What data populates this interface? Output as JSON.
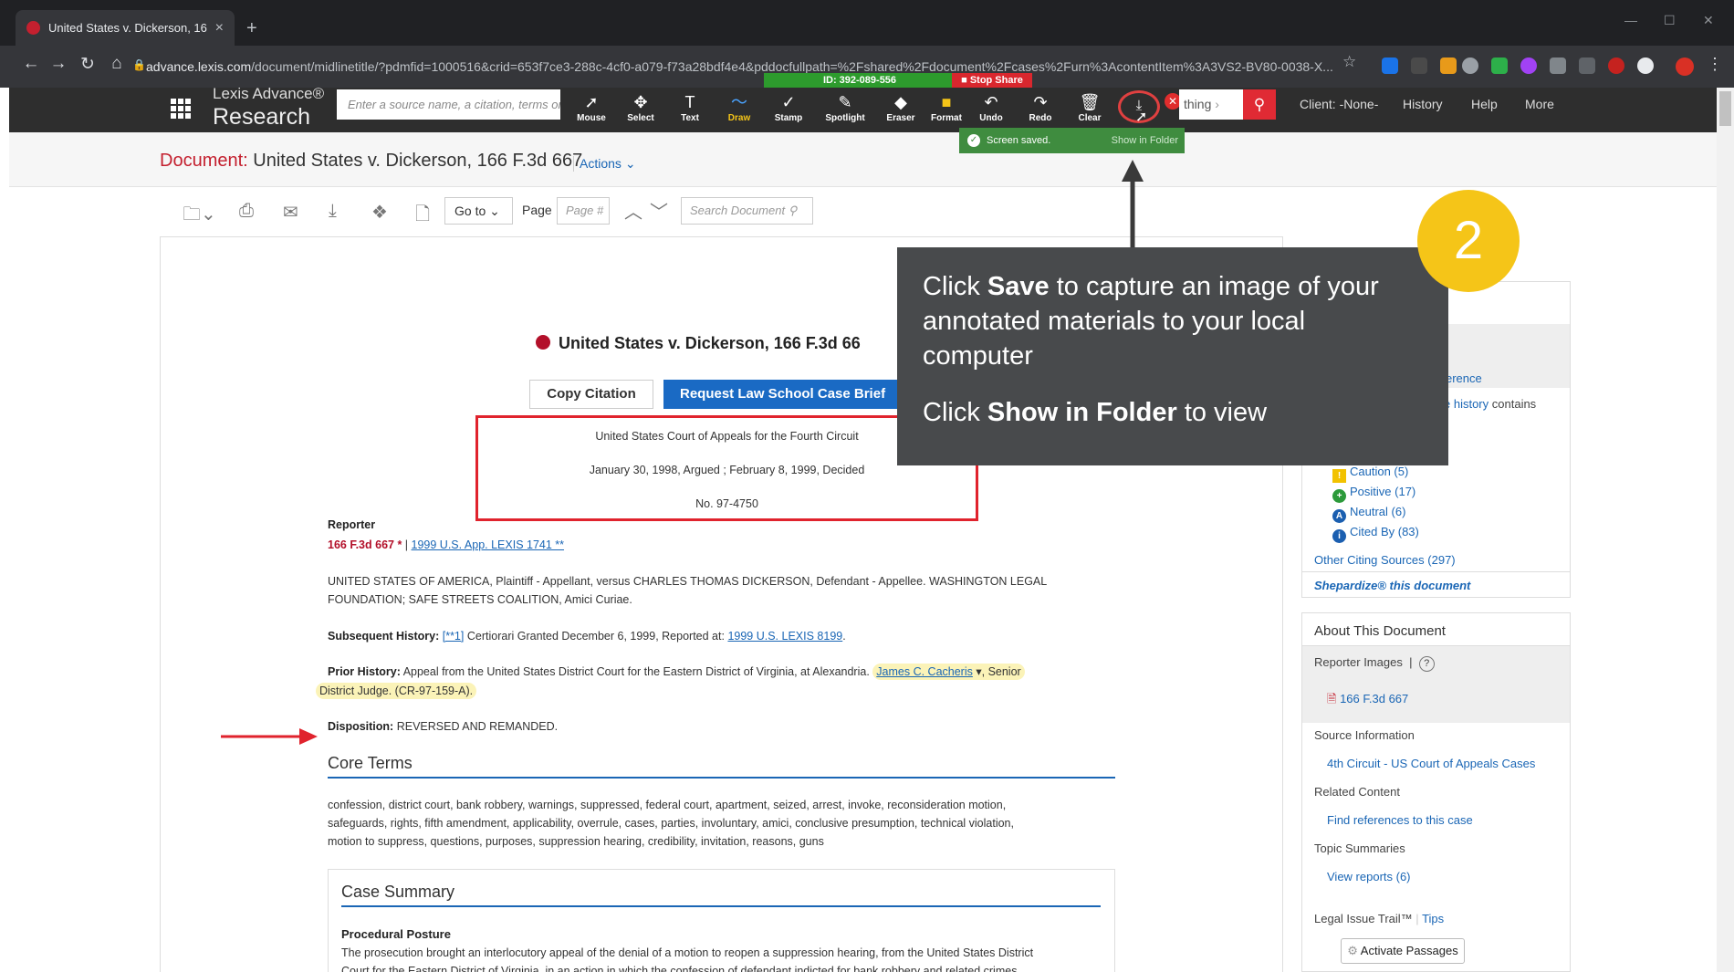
{
  "browser": {
    "tab_title": "United States v. Dickerson, 166 F",
    "tab_close": "×",
    "new_tab": "+",
    "url_domain": "advance.lexis.com",
    "url_path": "/document/midlinetitle/?pdmfid=1000516&crid=653f7ce3-288c-4cf0-a079-f73a28bdf4e4&pddocfullpath=%2Fshared%2Fdocument%2Fcases%2Furn%3AcontentItem%3A3VS2-BV80-0038-X..."
  },
  "lexis": {
    "brand_line1": "Lexis Advance®",
    "brand_line2": "Research",
    "search_placeholder": "Enter a source name, a citation, terms or s",
    "search_tail": "thing",
    "client": "Client: -None-",
    "history": "History",
    "help": "Help",
    "more": "More"
  },
  "zoom": {
    "id_label": "ID: 392-089-556",
    "stop_share": "Stop Share",
    "tools": [
      {
        "label": "Mouse",
        "icon": "➚"
      },
      {
        "label": "Select",
        "icon": "✥"
      },
      {
        "label": "Text",
        "icon": "T"
      },
      {
        "label": "Draw",
        "icon": "〜"
      },
      {
        "label": "Stamp",
        "icon": "✓"
      },
      {
        "label": "Spotlight",
        "icon": "✎"
      },
      {
        "label": "Eraser",
        "icon": "◆"
      },
      {
        "label": "Format",
        "icon": "■"
      },
      {
        "label": "Undo",
        "icon": "↶"
      },
      {
        "label": "Redo",
        "icon": "↷"
      },
      {
        "label": "Clear",
        "icon": "🗑"
      }
    ],
    "save_icon": "⤓",
    "close_x": "✕",
    "screen_saved": "Screen saved.",
    "show_in_folder": "Show in Folder"
  },
  "document": {
    "label": "Document:",
    "title": "United States v. Dickerson, 166 F.3d 667",
    "actions": "Actions",
    "goto": "Go to",
    "page_label": "Page",
    "page_placeholder": "Page #",
    "search_placeholder": "Search Document",
    "case_heading": "United States v. Dickerson, 166 F.3d 66",
    "copy_citation": "Copy Citation",
    "request_brief": "Request Law School Case Brief",
    "court": "United States Court of Appeals for the Fourth Circuit",
    "dates": "January 30, 1998, Argued ; February 8, 1999, Decided",
    "docket": "No. 97-4750",
    "reporter_label": "Reporter",
    "reporter_cite": "166 F.3d 667 *",
    "reporter_sep": "|",
    "reporter_link": "1999 U.S. App. LEXIS 1741 **",
    "parties_line1": "UNITED STATES OF AMERICA, Plaintiff - Appellant, versus CHARLES THOMAS DICKERSON, Defendant - Appellee. WASHINGTON LEGAL",
    "parties_line2": "FOUNDATION; SAFE STREETS COALITION, Amici Curiae.",
    "subsequent_label": "Subsequent History:",
    "subsequent_link1": "[**1]",
    "subsequent_text": "Certiorari Granted December 6, 1999, Reported at:",
    "subsequent_link2": "1999 U.S. LEXIS 8199",
    "prior_label": "Prior History:",
    "prior_text": "Appeal from the United States District Court for the Eastern District of Virginia, at Alexandria.",
    "prior_judge": "James C. Cacheris",
    "prior_tail": ", Senior",
    "prior_line2": "District Judge. (CR-97-159-A).",
    "disposition_label": "Disposition:",
    "disposition_text": "REVERSED AND REMANDED.",
    "core_terms_title": "Core Terms",
    "core_terms_line1": "confession, district court, bank robbery, warnings, suppressed, federal court, apartment, seized, arrest, invoke, reconsideration motion,",
    "core_terms_line2": "safeguards, rights, fifth amendment, applicability, overrule, cases, parties, involuntary, amici, conclusive presumption, technical violation,",
    "core_terms_line3": "motion to suppress, questions, purposes, suppression hearing, credibility, invitation, reasons, guns",
    "case_summary_title": "Case Summary",
    "procedural_posture": "Procedural Posture",
    "proc_line1": "The prosecution brought an interlocutory appeal of the denial of a motion to reopen a suppression hearing, from the United States District",
    "proc_line2": "Court for the Eastern District of Virginia, in an action in which the confession of defendant indicted for bank robbery and related crimes"
  },
  "right_panel": {
    "s_label": "s",
    "reference": "erence",
    "history_link": "e history",
    "history_tail": "contains",
    "signals": [
      {
        "label": "Caution (5)",
        "icon": "!",
        "color": "#f2c200"
      },
      {
        "label": "Positive (17)",
        "icon": "+",
        "color": "#2c9a3a"
      },
      {
        "label": "Neutral (6)",
        "icon": "A",
        "color": "#1b5fb0"
      },
      {
        "label": "Cited By (83)",
        "icon": "i",
        "color": "#1b5fb0"
      }
    ],
    "other_citing": "Other Citing Sources (297)",
    "shepardize": "Shepardize® this document",
    "about_title": "About This Document",
    "reporter_images": "Reporter Images",
    "reporter_sep": "|",
    "help_q": "?",
    "pdf_link": "166 F.3d 667",
    "source_info": "Source Information",
    "source_link": "4th Circuit - US Court of Appeals Cases",
    "related_content": "Related Content",
    "related_link": "Find references to this case",
    "topic_summaries": "Topic Summaries",
    "topic_link": "View reports (6)",
    "legal_issue": "Legal Issue Trail™",
    "tips": "Tips",
    "activate": "Activate Passages"
  },
  "overlay": {
    "click1": "Click",
    "save": "Save",
    "line1_tail": "to capture an image of your annotated materials to your local computer",
    "click2": "Click",
    "show_folder": "Show in Folder",
    "line2_tail": "to view",
    "step_number": "2"
  },
  "colors": {
    "lexis_red": "#c4202f",
    "link_blue": "#1a66b5",
    "zoom_green": "#2d9b2d",
    "callout_bg": "#484a4c",
    "step_yellow": "#f5c518"
  }
}
